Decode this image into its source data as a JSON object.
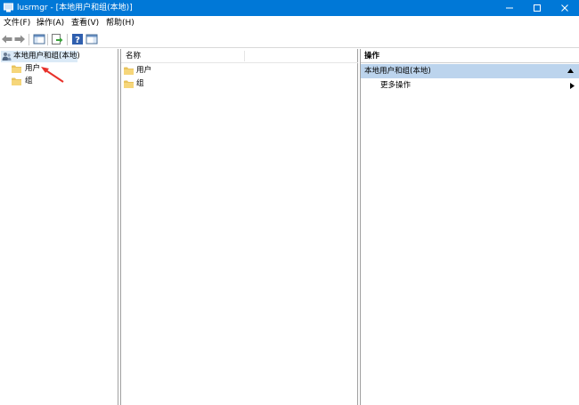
{
  "window": {
    "title": "lusrmgr - [本地用户和组(本地)]",
    "colors": {
      "titlebar": "#0078d7",
      "selection": "#dbeaf7",
      "action_group": "#bcd4ed",
      "arrow": "#e8312a"
    }
  },
  "menu": {
    "items": [
      {
        "label": "文件(F)"
      },
      {
        "label": "操作(A)"
      },
      {
        "label": "查看(V)"
      },
      {
        "label": "帮助(H)"
      }
    ]
  },
  "toolbar": {
    "icons": [
      "back-icon",
      "forward-icon",
      "show-hide-console-tree-icon",
      "export-list-icon",
      "help-icon",
      "show-hide-action-pane-icon"
    ]
  },
  "tree": {
    "root_label": "本地用户和组(本地)",
    "items": [
      {
        "label": "用户"
      },
      {
        "label": "组"
      }
    ]
  },
  "list": {
    "column_name": "名称",
    "items": [
      {
        "label": "用户"
      },
      {
        "label": "组"
      }
    ]
  },
  "actions": {
    "header": "操作",
    "group_label": "本地用户和组(本地)",
    "items": [
      {
        "label": "更多操作"
      }
    ]
  }
}
